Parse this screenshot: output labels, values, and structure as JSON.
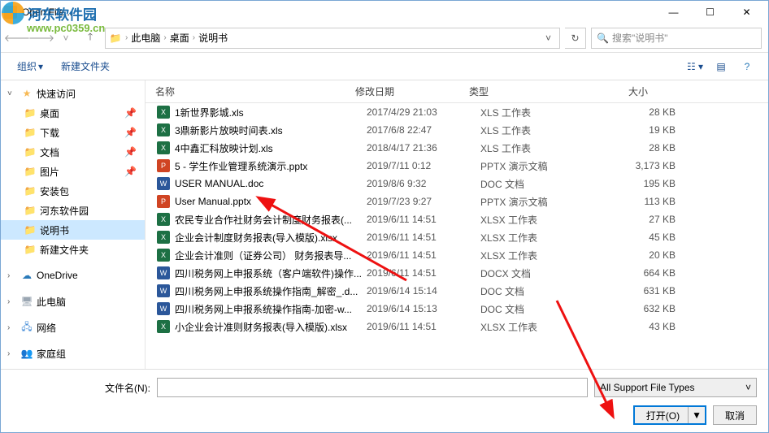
{
  "window": {
    "title": "Open File...",
    "close": "✕",
    "min": "—",
    "max": "☐"
  },
  "nav": {
    "breadcrumb": [
      "此电脑",
      "桌面",
      "说明书"
    ],
    "search_placeholder": "搜索\"说明书\""
  },
  "toolbar": {
    "organize": "组织",
    "newfolder": "新建文件夹"
  },
  "sidebar": {
    "quick": "快速访问",
    "items": [
      {
        "label": "桌面",
        "pin": true
      },
      {
        "label": "下载",
        "pin": true
      },
      {
        "label": "文档",
        "pin": true
      },
      {
        "label": "图片",
        "pin": true
      },
      {
        "label": "安装包"
      },
      {
        "label": "河东软件园"
      },
      {
        "label": "说明书",
        "sel": true
      },
      {
        "label": "新建文件夹"
      }
    ],
    "onedrive": "OneDrive",
    "thispc": "此电脑",
    "network": "网络",
    "homegroup": "家庭组"
  },
  "columns": {
    "name": "名称",
    "date": "修改日期",
    "type": "类型",
    "size": "大小"
  },
  "files": [
    {
      "icon": "xls",
      "name": "1新世界影城.xls",
      "date": "2017/4/29 21:03",
      "type": "XLS 工作表",
      "size": "28 KB"
    },
    {
      "icon": "xls",
      "name": "3鼎新影片放映时间表.xls",
      "date": "2017/6/8 22:47",
      "type": "XLS 工作表",
      "size": "19 KB"
    },
    {
      "icon": "xls",
      "name": "4中鑫汇科放映计划.xls",
      "date": "2018/4/17 21:36",
      "type": "XLS 工作表",
      "size": "28 KB"
    },
    {
      "icon": "pptx",
      "name": "5 - 学生作业管理系统演示.pptx",
      "date": "2019/7/11 0:12",
      "type": "PPTX 演示文稿",
      "size": "3,173 KB"
    },
    {
      "icon": "doc",
      "name": "USER MANUAL.doc",
      "date": "2019/8/6 9:32",
      "type": "DOC 文档",
      "size": "195 KB"
    },
    {
      "icon": "pptx",
      "name": "User Manual.pptx",
      "date": "2019/7/23 9:27",
      "type": "PPTX 演示文稿",
      "size": "113 KB"
    },
    {
      "icon": "xlsx",
      "name": "农民专业合作社财务会计制度财务报表(...",
      "date": "2019/6/11 14:51",
      "type": "XLSX 工作表",
      "size": "27 KB"
    },
    {
      "icon": "xlsx",
      "name": "企业会计制度财务报表(导入模版).xlsx",
      "date": "2019/6/11 14:51",
      "type": "XLSX 工作表",
      "size": "45 KB"
    },
    {
      "icon": "xlsx",
      "name": "企业会计准则（证券公司） 财务报表导...",
      "date": "2019/6/11 14:51",
      "type": "XLSX 工作表",
      "size": "20 KB"
    },
    {
      "icon": "docx",
      "name": "四川税务网上申报系统（客户端软件)操作...",
      "date": "2019/6/11 14:51",
      "type": "DOCX 文档",
      "size": "664 KB"
    },
    {
      "icon": "doc",
      "name": "四川税务网上申报系统操作指南_解密_.d...",
      "date": "2019/6/14 15:14",
      "type": "DOC 文档",
      "size": "631 KB"
    },
    {
      "icon": "doc",
      "name": "四川税务网上申报系统操作指南-加密-w...",
      "date": "2019/6/14 15:13",
      "type": "DOC 文档",
      "size": "632 KB"
    },
    {
      "icon": "xlsx",
      "name": "小企业会计准则财务报表(导入模版).xlsx",
      "date": "2019/6/11 14:51",
      "type": "XLSX 工作表",
      "size": "43 KB"
    }
  ],
  "footer": {
    "filename_label": "文件名(N):",
    "filter": "All Support File Types",
    "open": "打开(O)",
    "cancel": "取消"
  },
  "watermark": {
    "text": "河东软件园",
    "url": "www.pc0359.cn"
  }
}
